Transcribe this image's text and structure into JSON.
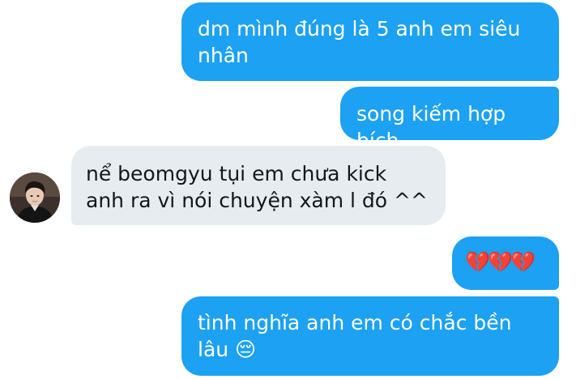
{
  "conversation": {
    "messages": [
      {
        "direction": "outgoing",
        "text": "dm mình đúng là 5 anh em siêu nhân"
      },
      {
        "direction": "outgoing",
        "text": "song kiếm hợp bích"
      },
      {
        "direction": "incoming",
        "text": "nể beomgyu tụi em chưa kick anh ra vì nói chuyện xàm l đó ^^"
      },
      {
        "direction": "outgoing",
        "text": "💔💔💔"
      },
      {
        "direction": "outgoing",
        "text": "tình nghĩa anh em có chắc bền lâu 😔"
      }
    ]
  },
  "colors": {
    "outgoing_bubble": "#1da1f2",
    "incoming_bubble": "#e6ecf0",
    "background": "#ffffff"
  },
  "icons": {
    "avatar": "contact-avatar-photo"
  }
}
